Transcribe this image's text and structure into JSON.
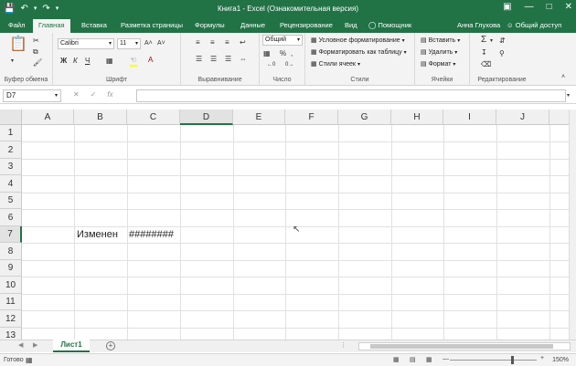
{
  "window": {
    "title": "Книга1 - Excel (Ознакомительная версия)",
    "accent_color": "#217346"
  },
  "tabs": [
    {
      "label": "Файл"
    },
    {
      "label": "Главная"
    },
    {
      "label": "Вставка"
    },
    {
      "label": "Разметка страницы"
    },
    {
      "label": "Формулы"
    },
    {
      "label": "Данные"
    },
    {
      "label": "Рецензирование"
    },
    {
      "label": "Вид"
    }
  ],
  "header_right": {
    "help_label": "Помощник",
    "user_name": "Анна Глухова",
    "share_label": "Общий доступ"
  },
  "ribbon": {
    "clipboard_label": "Буфер обмена",
    "font_label": "Шрифт",
    "font_name": "Calibri",
    "font_size": "11",
    "bold": "Ж",
    "italic": "К",
    "underline": "Ч",
    "alignment_label": "Выравнивание",
    "number_label": "Число",
    "number_format": "Общий",
    "styles_label": "Стили",
    "conditional_formatting": "Условное форматирование",
    "format_as_table": "Форматировать как таблицу",
    "cell_styles": "Стили ячеек",
    "cells_label": "Ячейки",
    "insert_label": "Вставить",
    "delete_label": "Удалить",
    "format_label": "Формат",
    "editing_label": "Редактирование"
  },
  "formula_bar": {
    "name_box": "D7",
    "formula_value": ""
  },
  "grid": {
    "columns": [
      "A",
      "B",
      "C",
      "D",
      "E",
      "F",
      "G",
      "H",
      "I",
      "J"
    ],
    "rows": [
      "1",
      "2",
      "3",
      "4",
      "5",
      "6",
      "7",
      "8",
      "9",
      "10",
      "11",
      "12",
      "13"
    ],
    "cells": {
      "B7": "Изменен",
      "C7": "########"
    }
  },
  "sheets": [
    {
      "label": "Лист1",
      "active": true
    }
  ],
  "status": {
    "ready": "Готово",
    "zoom": "150%"
  }
}
